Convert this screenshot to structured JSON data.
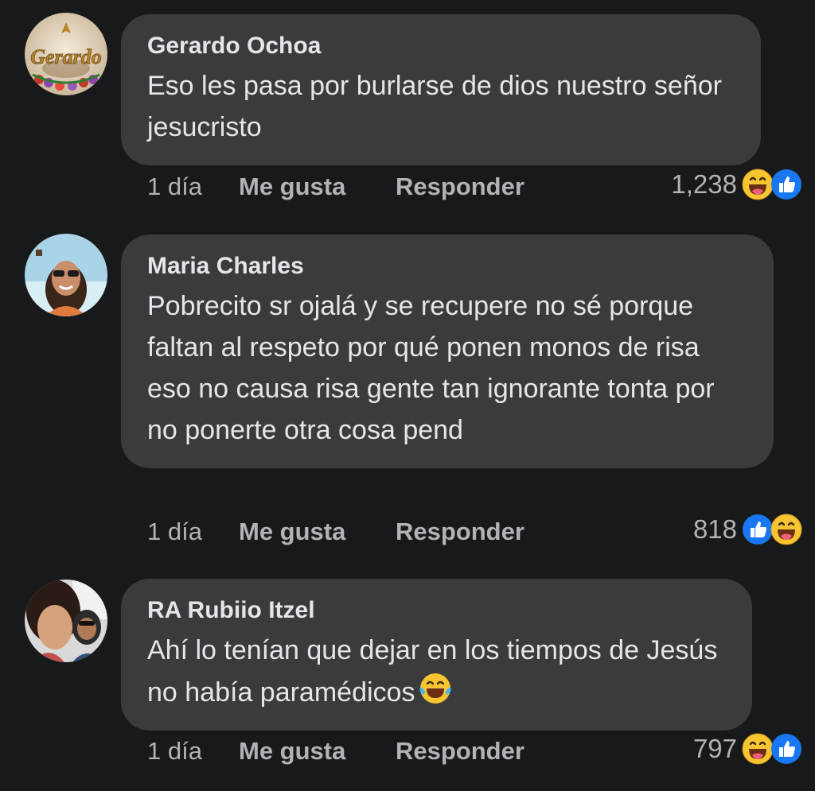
{
  "comments": [
    {
      "author": "Gerardo Ochoa",
      "text": "Eso les pasa por burlarse de dios nuestro señor jesucristo",
      "avatar_text": "Gerardo",
      "time": "1 día",
      "like_label": "Me gusta",
      "reply_label": "Responder",
      "reaction_count": "1,238",
      "reactions": [
        "haha-icon",
        "like-icon"
      ]
    },
    {
      "author": "Maria Charles",
      "text": "Pobrecito sr ojalá y se recupere no sé porque faltan al respeto por qué ponen monos de risa eso no causa risa gente tan ignorante tonta por no ponerte otra cosa pend",
      "time": "1 día",
      "like_label": "Me gusta",
      "reply_label": "Responder",
      "reaction_count": "818",
      "reactions": [
        "like-icon",
        "haha-icon"
      ]
    },
    {
      "author": "RA Rubiio Itzel",
      "text": "Ahí lo tenían que dejar en los tiempos de Jesús no había paramédicos",
      "inline_emoji": "tears-of-joy-emoji",
      "time": "1 día",
      "like_label": "Me gusta",
      "reply_label": "Responder",
      "reaction_count": "797",
      "reactions": [
        "haha-icon",
        "like-icon"
      ]
    }
  ],
  "colors": {
    "background": "#18191a",
    "bubble": "#3a3b3c",
    "text": "#e4e6eb",
    "secondary_text": "#b0b3b8",
    "like_blue": "#1877f2",
    "haha_yellow": "#f7c531"
  }
}
